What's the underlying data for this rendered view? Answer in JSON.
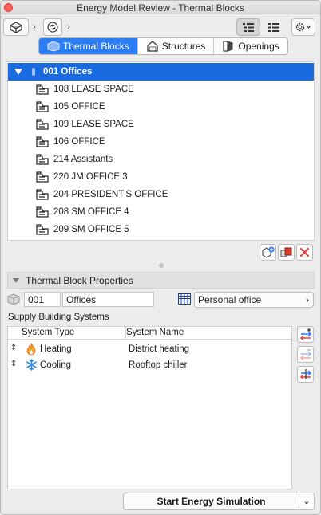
{
  "window": {
    "title": "Energy Model Review - Thermal Blocks"
  },
  "toolbar": {
    "icons": [
      "model-3d-icon",
      "sync-icon",
      "list-view-icon",
      "detail-list-icon",
      "settings-gear-icon"
    ]
  },
  "tabs": [
    {
      "label": "Thermal Blocks",
      "active": true,
      "icon": "thermal-block-icon"
    },
    {
      "label": "Structures",
      "active": false,
      "icon": "structure-house-icon"
    },
    {
      "label": "Openings",
      "active": false,
      "icon": "opening-door-icon"
    }
  ],
  "tree": {
    "root": {
      "label": "001 Offices",
      "expanded": true,
      "selected": true
    },
    "items": [
      "108 LEASE SPACE",
      "105 OFFICE",
      "109 LEASE SPACE",
      "106 OFFICE",
      "214 Assistants",
      "220 JM OFFICE 3",
      "204 PRESIDENT'S OFFICE",
      "208 SM OFFICE 4",
      "209 SM OFFICE 5"
    ]
  },
  "tree_actions": [
    "add-block-icon",
    "merge-block-icon",
    "delete-icon"
  ],
  "properties": {
    "header": "Thermal Block Properties",
    "id_value": "001",
    "name_value": "Offices",
    "profile": "Personal office"
  },
  "supply": {
    "section_label": "Supply Building Systems",
    "columns": [
      "System Type",
      "System Name"
    ],
    "rows": [
      {
        "type": "Heating",
        "name": "District heating",
        "icon": "flame-icon"
      },
      {
        "type": "Cooling",
        "name": "Rooftop chiller",
        "icon": "snowflake-icon"
      }
    ]
  },
  "simulation": {
    "button_label": "Start Energy Simulation"
  },
  "colors": {
    "accent": "#2b7cf7",
    "selection": "#1a6ae0",
    "close": "#fe5f57",
    "delete": "#e0443e"
  }
}
